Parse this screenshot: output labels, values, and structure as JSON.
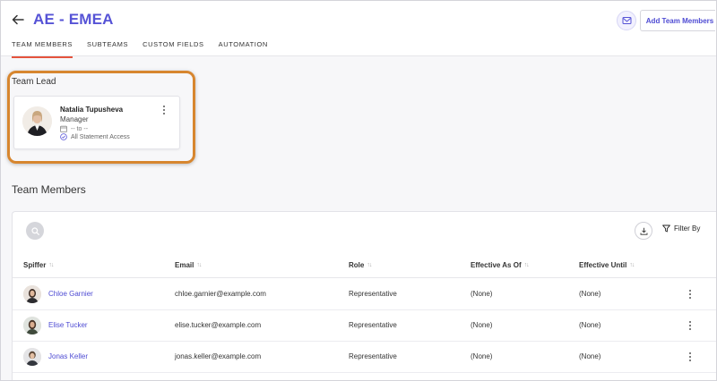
{
  "header": {
    "title": "AE - EMEA",
    "add_button_label": "Add Team Members"
  },
  "tabs": [
    {
      "label": "TEAM MEMBERS",
      "active": true
    },
    {
      "label": "SUBTEAMS",
      "active": false
    },
    {
      "label": "CUSTOM FIELDS",
      "active": false
    },
    {
      "label": "AUTOMATION",
      "active": false
    }
  ],
  "team_lead": {
    "section_label": "Team Lead",
    "name": "Natalia Tupusheva",
    "role": "Manager",
    "dates": "-- to --",
    "access": "All Statement Access"
  },
  "members": {
    "heading": "Team Members",
    "filter_label": "Filter By",
    "columns": [
      "Spiffer",
      "Email",
      "Role",
      "Effective As Of",
      "Effective Until"
    ],
    "rows": [
      {
        "name": "Chloe Garnier",
        "email": "chloe.garnier@example.com",
        "role": "Representative",
        "effective_as_of": "(None)",
        "effective_until": "(None)"
      },
      {
        "name": "Elise Tucker",
        "email": "elise.tucker@example.com",
        "role": "Representative",
        "effective_as_of": "(None)",
        "effective_until": "(None)"
      },
      {
        "name": "Jonas Keller",
        "email": "jonas.keller@example.com",
        "role": "Representative",
        "effective_as_of": "(None)",
        "effective_until": "(None)"
      }
    ]
  },
  "colors": {
    "accent": "#5653d6",
    "tab_underline": "#e5533d",
    "highlight": "#d7862f"
  }
}
